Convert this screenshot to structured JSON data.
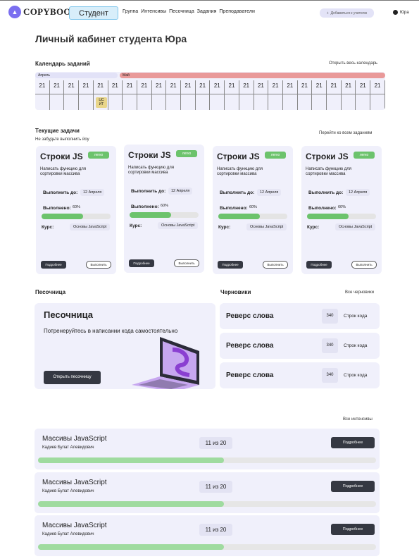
{
  "header": {
    "logo": "COPYBOOK",
    "role": "Студент",
    "nav": [
      "Группа",
      "Интенсивы",
      "Песочница",
      "Задания",
      "Преподаватели"
    ],
    "add_teacher": "Добавиться к учителю",
    "user": "Юра"
  },
  "page_title": "Личный кабинет студента Юра",
  "calendar": {
    "title": "Календарь заданий",
    "link": "Открыть весь календарь",
    "months": [
      "Апрель",
      "Май"
    ],
    "days": [
      "21",
      "21",
      "21",
      "21",
      "21",
      "21",
      "21",
      "21",
      "21",
      "21",
      "21",
      "21",
      "21",
      "21",
      "21",
      "21",
      "21",
      "21",
      "21",
      "21",
      "21",
      "21",
      "21",
      "21"
    ],
    "event": {
      "line1": "ЦС",
      "line2": "ИТ"
    }
  },
  "tasks": {
    "title": "Текущие задачи",
    "subtitle": "Не забудьте выполнить йоу",
    "link": "Перейти ко всем заданиям",
    "cards": [
      {
        "title": "Строки JS",
        "badge": "легко",
        "desc": "Написать функцию для сортировки массива",
        "due_label": "Выполнить до:",
        "due": "12 Апреля",
        "done_label": "Выполнено:",
        "done": "60%",
        "progress": 0.6,
        "course_label": "Курс:",
        "course": "Основы JavaScript",
        "more": "Подробнее",
        "do": "Выполнить"
      },
      {
        "title": "Строки JS",
        "badge": "легко",
        "desc": "Написать функцию для сортировки массива",
        "due_label": "Выполнить до:",
        "due": "12 Апреля",
        "done_label": "Выполнено:",
        "done": "60%",
        "progress": 0.6,
        "course_label": "Курс:",
        "course": "Основы JavaScript",
        "more": "Подробнее",
        "do": "Выполнить"
      },
      {
        "title": "Строки JS",
        "badge": "легко",
        "desc": "Написать функцию для сортировки массива",
        "due_label": "Выполнить до:",
        "due": "12 Апреля",
        "done_label": "Выполнено:",
        "done": "60%",
        "progress": 0.6,
        "course_label": "Курс:",
        "course": "Основы JavaScript",
        "more": "Подробнее",
        "do": "Выполнить"
      },
      {
        "title": "Строки JS",
        "badge": "легко",
        "desc": "Написать функцию для сортировки массива",
        "due_label": "Выполнить до:",
        "due": "12 Апреля",
        "done_label": "Выполнено:",
        "done": "60%",
        "progress": 0.6,
        "course_label": "Курс:",
        "course": "Основы JavaScript",
        "more": "Подробнее",
        "do": "Выполнить"
      }
    ]
  },
  "sandbox": {
    "section_title": "Песочница",
    "title": "Песочница",
    "subtitle": "Потренеруйтесь в написании кода самостоятельно",
    "button": "Открыть песочницу"
  },
  "drafts": {
    "title": "Черновики",
    "link": "Все черновики",
    "items": [
      {
        "name": "Реверс слова",
        "count": "340",
        "unit": "Строк кода"
      },
      {
        "name": "Реверс слова",
        "count": "340",
        "unit": "Строк кода"
      },
      {
        "name": "Реверс слова",
        "count": "340",
        "unit": "Строк кода"
      }
    ]
  },
  "intensives": {
    "link": "Все интенсивы",
    "items": [
      {
        "name": "Массивы JavaScript",
        "author": "Кадиев Булат Алевидович",
        "progress_text": "11 из 20",
        "progress": 0.55,
        "button": "Подробнее"
      },
      {
        "name": "Массивы JavaScript",
        "author": "Кадиев Булат Алевидович",
        "progress_text": "11 из 20",
        "progress": 0.55,
        "button": "Подробнее"
      },
      {
        "name": "Массивы JavaScript",
        "author": "Кадиев Булат Алевидович",
        "progress_text": "11 из 20",
        "progress": 0.55,
        "button": "Подробнее"
      }
    ]
  },
  "colors": {
    "accent": "#7b6ff0",
    "success": "#6cc36c",
    "card_bg": "#f0f0fb",
    "may_bar": "#e99999"
  }
}
